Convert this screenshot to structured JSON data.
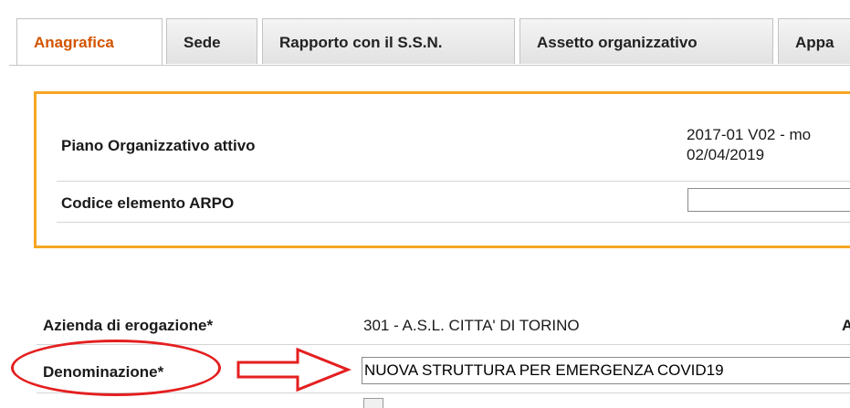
{
  "tabs": [
    {
      "label": "Anagrafica",
      "active": true
    },
    {
      "label": "Sede",
      "active": false
    },
    {
      "label": "Rapporto con il S.S.N.",
      "active": false
    },
    {
      "label": "Assetto organizzativo",
      "active": false
    },
    {
      "label": "Appa",
      "active": false
    }
  ],
  "piano": {
    "label": "Piano Organizzativo attivo",
    "value_line1": "2017-01 V02 - mo",
    "value_line2": "02/04/2019"
  },
  "codice_arpo": {
    "label": "Codice elemento ARPO",
    "value": ""
  },
  "azienda": {
    "label": "Azienda di erogazione*",
    "value": "301 - A.S.L. CITTA' DI TORINO",
    "clipped_right": "A"
  },
  "denominazione": {
    "label": "Denominazione*",
    "value": "NUOVA STRUTTURA PER EMERGENZA COVID19"
  },
  "colors": {
    "active_tab": "#d35400",
    "frame": "#f5a623",
    "annotation": "#e41f1f"
  }
}
